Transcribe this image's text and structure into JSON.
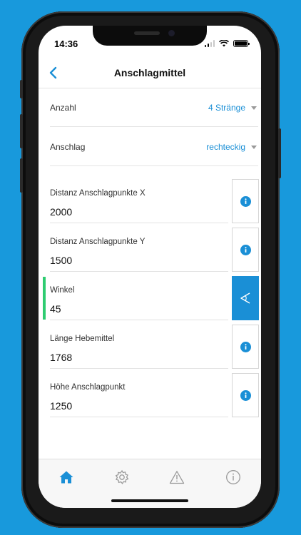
{
  "status": {
    "time": "14:36"
  },
  "nav": {
    "title": "Anschlagmittel"
  },
  "selects": [
    {
      "label": "Anzahl",
      "value": "4 Stränge"
    },
    {
      "label": "Anschlag",
      "value": "rechteckig"
    }
  ],
  "fields": [
    {
      "label": "Distanz Anschlagpunkte X",
      "value": "2000",
      "action": "info-icon"
    },
    {
      "label": "Distanz Anschlagpunkte Y",
      "value": "1500",
      "action": "info-icon"
    },
    {
      "label": "Winkel",
      "value": "45",
      "action": "angle-icon",
      "active": true
    },
    {
      "label": "Länge Hebemittel",
      "value": "1768",
      "action": "info-icon"
    },
    {
      "label": "Höhe Anschlagpunkt",
      "value": "1250",
      "action": "info-icon"
    }
  ],
  "tabs": [
    {
      "icon": "home-icon",
      "active": true
    },
    {
      "icon": "gear-icon"
    },
    {
      "icon": "warning-icon"
    },
    {
      "icon": "info-icon"
    }
  ],
  "colors": {
    "background": "#1899DC",
    "accent": "#1a8fd6",
    "active_marker": "#2ecc71"
  }
}
